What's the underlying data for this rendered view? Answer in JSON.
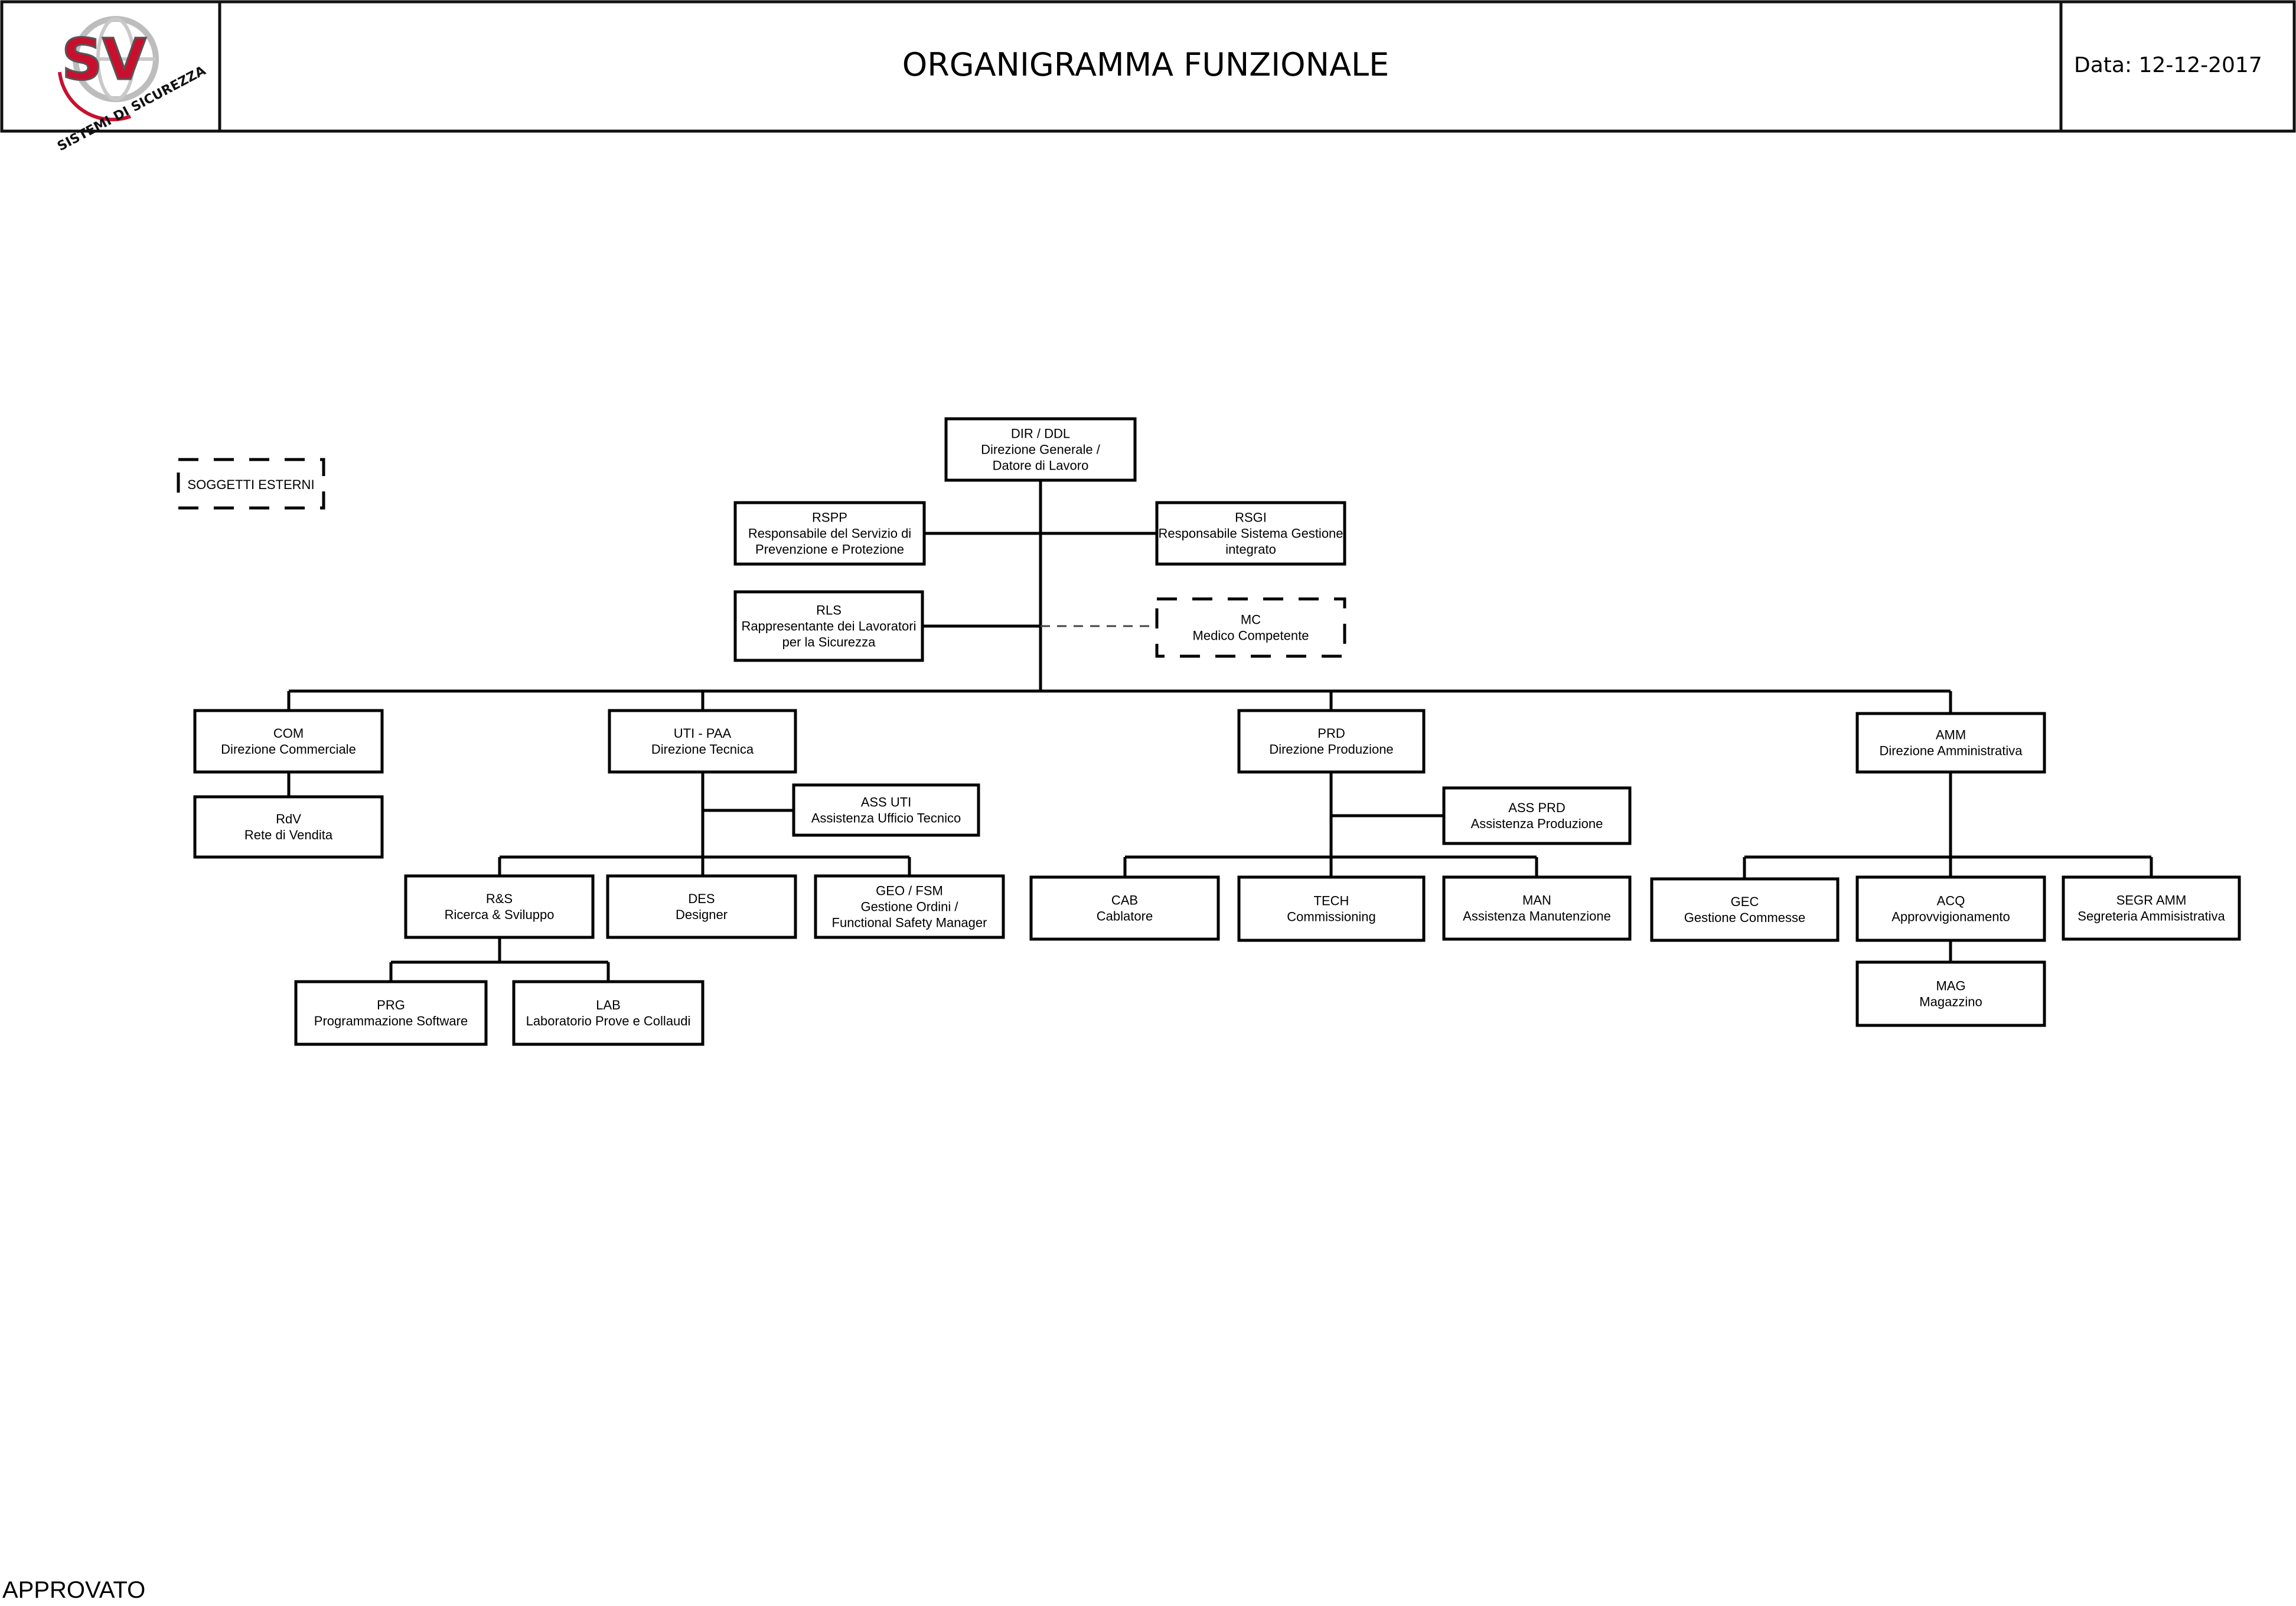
{
  "header": {
    "title": "ORGANIGRAMMA FUNZIONALE",
    "date_label": "Data: 12-12-2017",
    "logo": {
      "monogram": "SV",
      "tagline": "SISTEMI DI SICUREZZA",
      "icon": "globe-logo-icon",
      "colors": {
        "red": "#c8102e",
        "grey": "#9a9a9a"
      }
    }
  },
  "legend": {
    "external_label": "SOGGETTI ESTERNI"
  },
  "nodes": [
    {
      "id": "dir",
      "code": "DIR / DDL",
      "desc": [
        "Direzione Generale /",
        "Datore di Lavoro"
      ],
      "style": "solid"
    },
    {
      "id": "rspp",
      "code": "RSPP",
      "desc": [
        "Responsabile del Servizio di",
        "Prevenzione e Protezione"
      ],
      "style": "solid"
    },
    {
      "id": "rsgi",
      "code": "RSGI",
      "desc": [
        "Responsabile Sistema Gestione",
        "integrato"
      ],
      "style": "solid"
    },
    {
      "id": "rls",
      "code": "RLS",
      "desc": [
        "Rappresentante dei Lavoratori",
        "per la Sicurezza"
      ],
      "style": "solid"
    },
    {
      "id": "mc",
      "code": "MC",
      "desc": [
        "Medico Competente"
      ],
      "style": "dashed"
    },
    {
      "id": "com",
      "code": "COM",
      "desc": [
        "Direzione Commerciale"
      ],
      "style": "solid"
    },
    {
      "id": "rdv",
      "code": "RdV",
      "desc": [
        "Rete di Vendita"
      ],
      "style": "solid"
    },
    {
      "id": "uti",
      "code": "UTI - PAA",
      "desc": [
        "Direzione Tecnica"
      ],
      "style": "solid"
    },
    {
      "id": "assuti",
      "code": "ASS UTI",
      "desc": [
        "Assistenza Ufficio Tecnico"
      ],
      "style": "solid"
    },
    {
      "id": "rs",
      "code": "R&S",
      "desc": [
        "Ricerca & Sviluppo"
      ],
      "style": "solid"
    },
    {
      "id": "des",
      "code": "DES",
      "desc": [
        "Designer"
      ],
      "style": "solid"
    },
    {
      "id": "geo",
      "code": "GEO / FSM",
      "desc": [
        "Gestione Ordini /",
        "Functional Safety Manager"
      ],
      "style": "solid"
    },
    {
      "id": "prg",
      "code": "PRG",
      "desc": [
        "Programmazione Software"
      ],
      "style": "solid"
    },
    {
      "id": "lab",
      "code": "LAB",
      "desc": [
        "Laboratorio Prove e Collaudi"
      ],
      "style": "solid"
    },
    {
      "id": "prd",
      "code": "PRD",
      "desc": [
        "Direzione Produzione"
      ],
      "style": "solid"
    },
    {
      "id": "assprd",
      "code": "ASS PRD",
      "desc": [
        "Assistenza Produzione"
      ],
      "style": "solid"
    },
    {
      "id": "cab",
      "code": "CAB",
      "desc": [
        "Cablatore"
      ],
      "style": "solid"
    },
    {
      "id": "tech",
      "code": "TECH",
      "desc": [
        "Commissioning"
      ],
      "style": "solid"
    },
    {
      "id": "man",
      "code": "MAN",
      "desc": [
        "Assistenza Manutenzione"
      ],
      "style": "solid"
    },
    {
      "id": "amm",
      "code": "AMM",
      "desc": [
        "Direzione Amministrativa"
      ],
      "style": "solid"
    },
    {
      "id": "gec",
      "code": "GEC",
      "desc": [
        "Gestione Commesse"
      ],
      "style": "solid"
    },
    {
      "id": "acq",
      "code": "ACQ",
      "desc": [
        "Approvvigionamento"
      ],
      "style": "solid"
    },
    {
      "id": "segr",
      "code": "SEGR AMM",
      "desc": [
        "Segreteria Ammisistrativa"
      ],
      "style": "solid"
    },
    {
      "id": "mag",
      "code": "MAG",
      "desc": [
        "Magazzino"
      ],
      "style": "solid"
    }
  ],
  "edges": [
    {
      "from": "dir",
      "to": "rspp",
      "style": "solid"
    },
    {
      "from": "dir",
      "to": "rsgi",
      "style": "solid"
    },
    {
      "from": "dir",
      "to": "rls",
      "style": "solid"
    },
    {
      "from": "dir",
      "to": "mc",
      "style": "dashed"
    },
    {
      "from": "dir",
      "to": "com",
      "style": "solid"
    },
    {
      "from": "dir",
      "to": "uti",
      "style": "solid"
    },
    {
      "from": "dir",
      "to": "prd",
      "style": "solid"
    },
    {
      "from": "dir",
      "to": "amm",
      "style": "solid"
    },
    {
      "from": "com",
      "to": "rdv",
      "style": "solid"
    },
    {
      "from": "uti",
      "to": "assuti",
      "style": "solid"
    },
    {
      "from": "uti",
      "to": "rs",
      "style": "solid"
    },
    {
      "from": "uti",
      "to": "des",
      "style": "solid"
    },
    {
      "from": "uti",
      "to": "geo",
      "style": "solid"
    },
    {
      "from": "rs",
      "to": "prg",
      "style": "solid"
    },
    {
      "from": "rs",
      "to": "lab",
      "style": "solid"
    },
    {
      "from": "prd",
      "to": "assprd",
      "style": "solid"
    },
    {
      "from": "prd",
      "to": "cab",
      "style": "solid"
    },
    {
      "from": "prd",
      "to": "tech",
      "style": "solid"
    },
    {
      "from": "prd",
      "to": "man",
      "style": "solid"
    },
    {
      "from": "amm",
      "to": "gec",
      "style": "solid"
    },
    {
      "from": "amm",
      "to": "acq",
      "style": "solid"
    },
    {
      "from": "amm",
      "to": "segr",
      "style": "solid"
    },
    {
      "from": "acq",
      "to": "mag",
      "style": "solid"
    }
  ],
  "footer": {
    "status": "APPROVATO"
  }
}
